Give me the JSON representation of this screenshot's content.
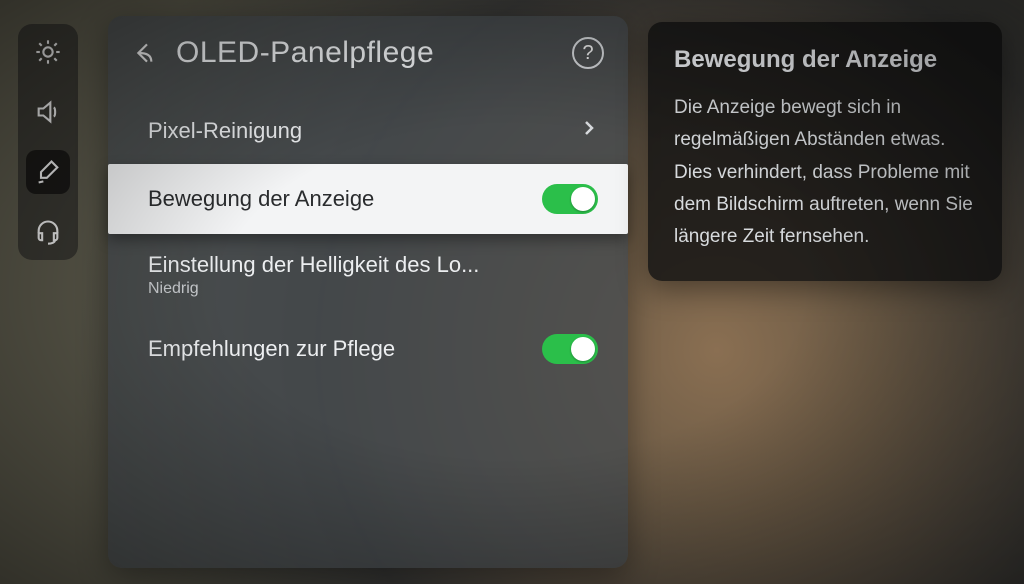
{
  "rail": {
    "items": [
      {
        "name": "brightness-icon",
        "active": false
      },
      {
        "name": "sound-icon",
        "active": false
      },
      {
        "name": "settings-icon",
        "active": true
      },
      {
        "name": "support-icon",
        "active": false
      }
    ]
  },
  "panel": {
    "title": "OLED-Panelpflege",
    "help_aria": "Hilfe",
    "rows": [
      {
        "label": "Pixel-Reinigung",
        "type": "nav"
      },
      {
        "label": "Bewegung der Anzeige",
        "type": "toggle",
        "on": true,
        "selected": true
      },
      {
        "label": "Einstellung der Helligkeit des Lo...",
        "sub": "Niedrig",
        "type": "nav"
      },
      {
        "label": "Empfehlungen zur Pflege",
        "type": "toggle",
        "on": true
      }
    ]
  },
  "info": {
    "title": "Bewegung der Anzeige",
    "body": "Die Anzeige bewegt sich in regelmäßigen Abständen etwas. Dies verhindert, dass Probleme mit dem Bildschirm auftreten, wenn Sie längere Zeit fernsehen."
  }
}
